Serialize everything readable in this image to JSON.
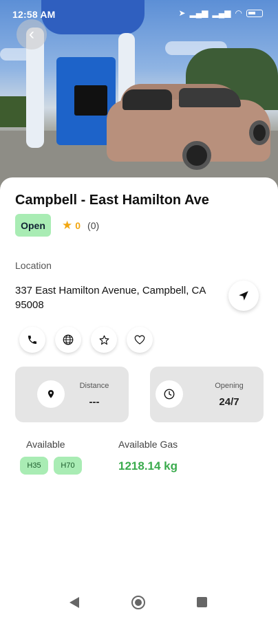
{
  "status_bar": {
    "time": "12:58 AM"
  },
  "station": {
    "name": "Campbell - East Hamilton Ave",
    "status": "Open",
    "rating": "0",
    "review_count": "(0)",
    "location_label": "Location",
    "address": "337 East Hamilton Avenue, Campbell, CA 95008"
  },
  "info_cards": {
    "distance_label": "Distance",
    "distance_value": "---",
    "opening_label": "Opening",
    "opening_value": "24/7"
  },
  "availability": {
    "label": "Available",
    "types": [
      "H35",
      "H70"
    ],
    "gas_label": "Available Gas",
    "gas_value": "1218.14 kg"
  },
  "colors": {
    "accent_green": "#3aab4d",
    "badge_green": "#a9ecb4",
    "star": "#f2a712"
  }
}
